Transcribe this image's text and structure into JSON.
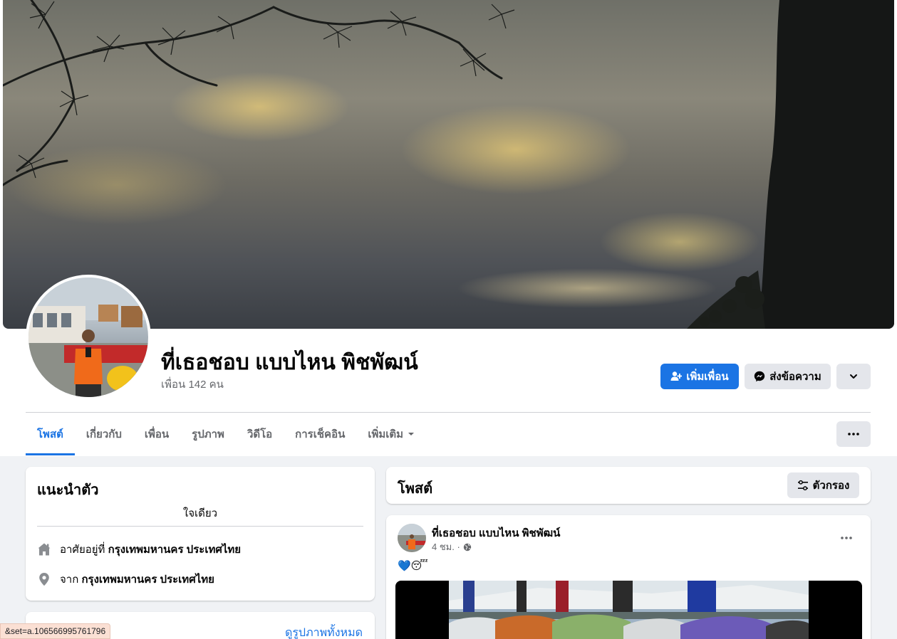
{
  "profile": {
    "name": "ที่เธอชอบ แบบไหน พิชพัฒน์",
    "friends_text": "เพื่อน 142 คน"
  },
  "actions": {
    "add_friend": "เพิ่มเพื่อน",
    "message": "ส่งข้อความ"
  },
  "tabs": [
    {
      "label": "โพสต์",
      "active": true
    },
    {
      "label": "เกี่ยวกับ",
      "active": false
    },
    {
      "label": "เพื่อน",
      "active": false
    },
    {
      "label": "รูปภาพ",
      "active": false
    },
    {
      "label": "วิดีโอ",
      "active": false
    },
    {
      "label": "การเช็คอิน",
      "active": false
    },
    {
      "label": "เพิ่มเติม",
      "active": false
    }
  ],
  "intro": {
    "title": "แนะนำตัว",
    "bio": "ใจเดียว",
    "lives_prefix": "อาศัยอยู่ที่",
    "lives_place": "กรุงเทพมหานคร ประเทศไทย",
    "from_prefix": "จาก",
    "from_place": "กรุงเทพมหานคร ประเทศไทย"
  },
  "photos": {
    "see_all": "ดูรูปภาพทั้งหมด"
  },
  "posts_header": {
    "title": "โพสต์",
    "filter": "ตัวกรอง"
  },
  "post": {
    "author": "ที่เธอชอบ แบบไหน พิชพัฒน์",
    "time": "4 ชม. ·",
    "text": "💙😴"
  },
  "status_url": "&set=a.106566995761796",
  "colors": {
    "accent": "#1b74e4",
    "secondary_text": "#65676b",
    "button_grey": "#e4e6eb",
    "page_bg": "#f0f2f5"
  },
  "icons": [
    "add-friend-icon",
    "messenger-icon",
    "chevron-down-icon",
    "more-icon",
    "home-icon",
    "location-pin-icon",
    "filter-icon",
    "globe-icon"
  ]
}
